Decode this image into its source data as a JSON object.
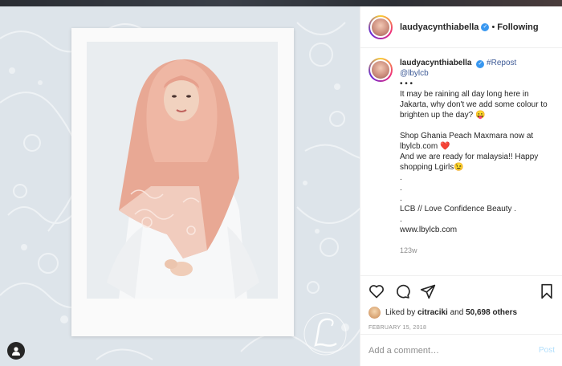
{
  "post": {
    "username": "laudyacynthiabella",
    "follow_status": "Following",
    "dot": "•",
    "verified_mark": "✓",
    "caption_username": "laudyacynthiabella",
    "repost_tag": "#Repost",
    "mention": "@lbylcb",
    "caption_lines": "• • •\nIt may be raining all day long here in Jakarta, why don't we add some colour to brighten up the day? 😛\n\nShop Ghania Peach Maxmara now at lbylcb.com ❤️\nAnd we are ready for malaysia!! Happy shopping Lgirls😉\n.\n.\n.\nLCB // Love Confidence Beauty .\n.\nwww.lbylcb.com",
    "age": "123w",
    "likes_prefix": "Liked by",
    "liked_by_user": "citraciki",
    "likes_and": "and",
    "likes_count": "50,698 others",
    "date": "FEBRUARY 15, 2018"
  },
  "comment_box": {
    "placeholder": "Add a comment…",
    "post_label": "Post"
  },
  "icons": {
    "like": "heart-icon",
    "comment": "comment-icon",
    "share": "share-icon",
    "save": "bookmark-icon",
    "user": "user-icon"
  },
  "colors": {
    "verified": "#3897f0",
    "post_disabled": "#b2dffc",
    "scarf": "#e8a894"
  }
}
